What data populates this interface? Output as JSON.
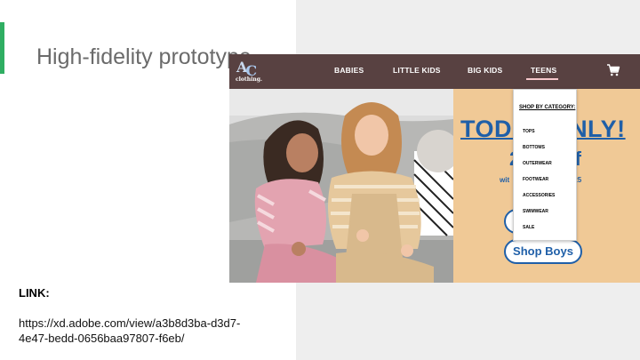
{
  "slide": {
    "title": "High-fidelity prototype",
    "link_label": "LINK:",
    "link_url": "https://xd.adobe.com/view/a3b8d3ba-d3d7-4e47-bedd-0656baa97807-f6eb/"
  },
  "colors": {
    "accent_bar": "#2fae62",
    "nav_bg": "#584141",
    "promo_bg": "#f0c996",
    "promo_text": "#1f5fa8"
  },
  "prototype": {
    "logo": {
      "mark": "AC",
      "text": "clothing."
    },
    "nav": [
      {
        "label": "BABIES",
        "active": false
      },
      {
        "label": "LITTLE KIDS",
        "active": false
      },
      {
        "label": "BIG KIDS",
        "active": false
      },
      {
        "label": "TEENS",
        "active": true
      }
    ],
    "cart_icon": "shopping-cart-icon",
    "dropdown": {
      "title": "SHOP BY CATEGORY:",
      "items": [
        "TOPS",
        "BOTTOMS",
        "OUTERWEAR",
        "FOOTWEAR",
        "ACCESSORIES",
        "SWIMWEAR",
        "SALE"
      ]
    },
    "promo": {
      "headline_left": "TOD",
      "headline_right": "NLY!",
      "mid_left": "2",
      "mid_right": "ff",
      "code_left": "wit",
      "code_right": "ter25",
      "shop_boys": "Shop Boys"
    }
  }
}
